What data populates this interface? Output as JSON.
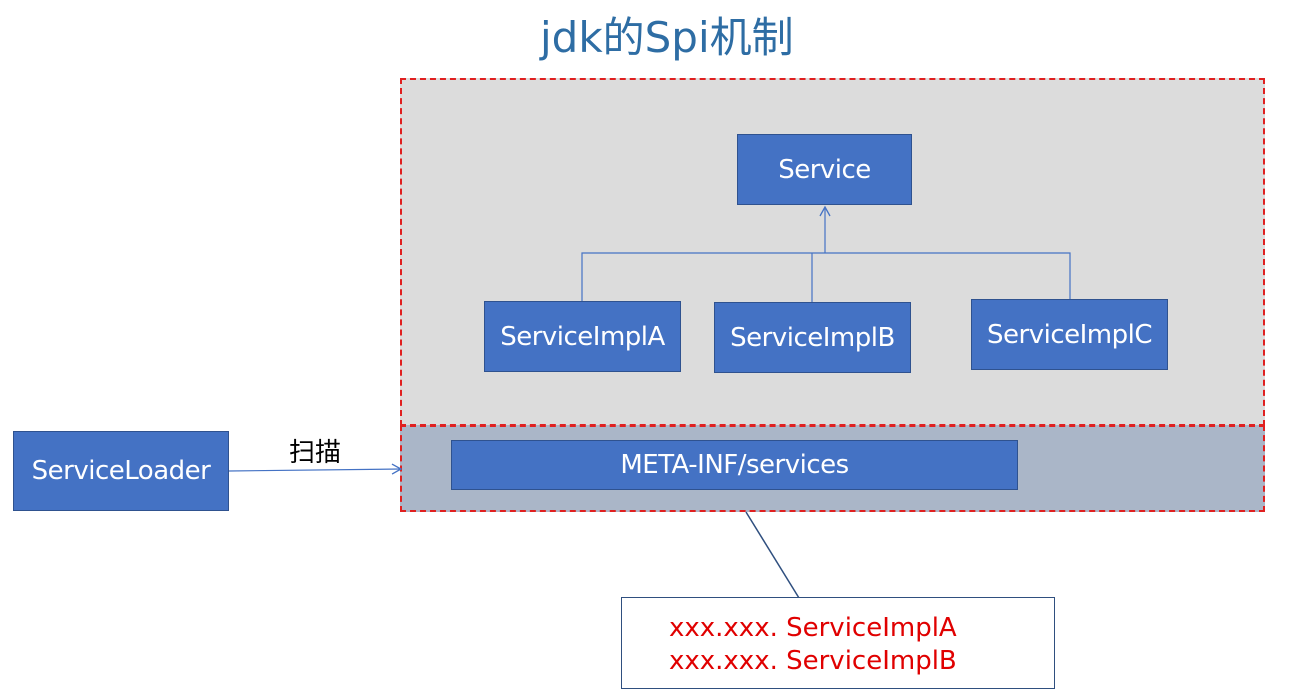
{
  "title": "jdk的Spi机制",
  "nodes": {
    "service": "Service",
    "impl_a": "ServiceImplA",
    "impl_b": "ServiceImplB",
    "impl_c": "ServiceImplC",
    "meta_inf": "META-INF/services",
    "service_loader": "ServiceLoader"
  },
  "edges": {
    "scan_label": "扫描"
  },
  "note": {
    "lines": [
      "xxx.xxx. ServiceImplA",
      "xxx.xxx. ServiceImplB"
    ]
  },
  "colors": {
    "box_fill": "#4472c4",
    "box_border": "#2f528f",
    "box_text": "#ffffff",
    "title": "#2e6da4",
    "dashed_border": "#e02020",
    "top_region_fill": "#dcdcdc",
    "bottom_region_fill": "#aab6c8",
    "note_text": "#e00000",
    "connector": "#4472c4"
  }
}
